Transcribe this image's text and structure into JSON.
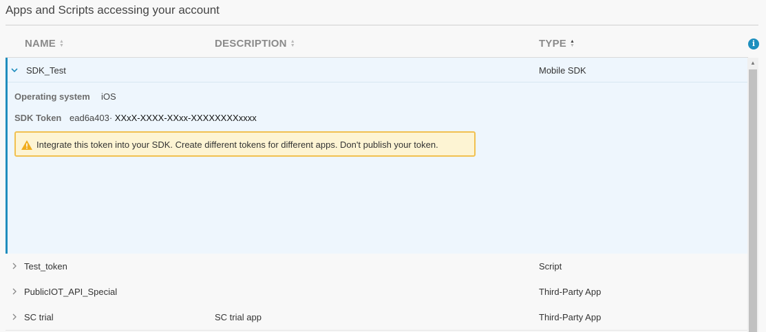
{
  "page": {
    "title": "Apps and Scripts accessing your account"
  },
  "columns": {
    "name": "NAME",
    "description": "DESCRIPTION",
    "type": "TYPE"
  },
  "info_icon": "i",
  "expanded": {
    "name": "SDK_Test",
    "type": "Mobile SDK",
    "os_label": "Operating system",
    "os_value": "iOS",
    "token_label": "SDK Token",
    "token_prefix": "ead6a403·",
    "token_masked": "XXxX-XXXX-XXxx-XXXXXXXXxxxx",
    "warning": "Integrate this token into your SDK. Create different tokens for different apps. Don't publish your token."
  },
  "rows": [
    {
      "name": "Test_token",
      "description": "",
      "type": "Script"
    },
    {
      "name": "PublicIOT_API_Special",
      "description": "",
      "type": "Third-Party App"
    },
    {
      "name": "SC trial",
      "description": "SC trial app",
      "type": "Third-Party App"
    }
  ],
  "colors": {
    "accent": "#1f8dbd",
    "warning_border": "#f1c04f",
    "warning_bg": "#fdf4d3",
    "expanded_bg": "#eef6fd"
  }
}
